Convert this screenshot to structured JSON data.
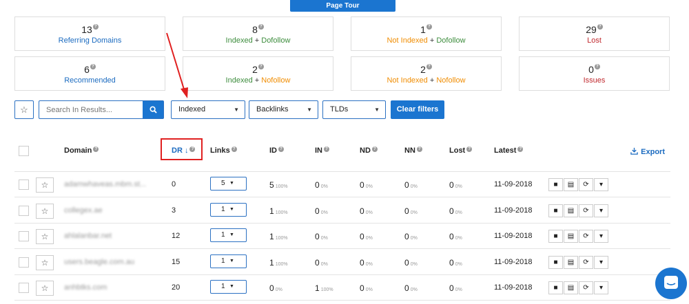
{
  "page_tour_label": "Page Tour",
  "stats": [
    {
      "value": "13",
      "label": "Referring Domains"
    },
    {
      "value": "8",
      "label_a": "Indexed",
      "plus": " + ",
      "label_b": "Dofollow"
    },
    {
      "value": "1",
      "label_a": "Not Indexed",
      "plus": " + ",
      "label_b": "Dofollow"
    },
    {
      "value": "29",
      "label": "Lost"
    },
    {
      "value": "6",
      "label": "Recommended"
    },
    {
      "value": "2",
      "label_a": "Indexed",
      "plus": " + ",
      "label_b": "Nofollow"
    },
    {
      "value": "2",
      "label_a": "Not Indexed",
      "plus": " + ",
      "label_b": "Nofollow"
    },
    {
      "value": "0",
      "label": "Issues"
    }
  ],
  "filters": {
    "search_placeholder": "Search In Results...",
    "indexed": "Indexed",
    "backlinks": "Backlinks",
    "tlds": "TLDs",
    "clear": "Clear filters"
  },
  "table": {
    "headers": {
      "domain": "Domain",
      "dr": "DR",
      "links": "Links",
      "id": "ID",
      "in": "IN",
      "nd": "ND",
      "nn": "NN",
      "lost": "Lost",
      "latest": "Latest",
      "export": "Export"
    },
    "rows": [
      {
        "domain": "adamwhaveas.mbm.st...",
        "dr": "0",
        "links": "5",
        "id": "5",
        "id_pct": "100%",
        "in": "0",
        "in_pct": "0%",
        "nd": "0",
        "nd_pct": "0%",
        "nn": "0",
        "nn_pct": "0%",
        "lost": "0",
        "lost_pct": "0%",
        "latest": "11-09-2018"
      },
      {
        "domain": "collegex.ae",
        "dr": "3",
        "links": "1",
        "id": "1",
        "id_pct": "100%",
        "in": "0",
        "in_pct": "0%",
        "nd": "0",
        "nd_pct": "0%",
        "nn": "0",
        "nn_pct": "0%",
        "lost": "0",
        "lost_pct": "0%",
        "latest": "11-09-2018"
      },
      {
        "domain": "ahlalanbar.net",
        "dr": "12",
        "links": "1",
        "id": "1",
        "id_pct": "100%",
        "in": "0",
        "in_pct": "0%",
        "nd": "0",
        "nd_pct": "0%",
        "nn": "0",
        "nn_pct": "0%",
        "lost": "0",
        "lost_pct": "0%",
        "latest": "11-09-2018"
      },
      {
        "domain": "users.beagle.com.au",
        "dr": "15",
        "links": "1",
        "id": "1",
        "id_pct": "100%",
        "in": "0",
        "in_pct": "0%",
        "nd": "0",
        "nd_pct": "0%",
        "nn": "0",
        "nn_pct": "0%",
        "lost": "0",
        "lost_pct": "0%",
        "latest": "11-09-2018"
      },
      {
        "domain": "anhbtks.com",
        "dr": "20",
        "links": "1",
        "id": "0",
        "id_pct": "0%",
        "in": "1",
        "in_pct": "100%",
        "nd": "0",
        "nd_pct": "0%",
        "nn": "0",
        "nn_pct": "0%",
        "lost": "0",
        "lost_pct": "0%",
        "latest": "11-09-2018"
      }
    ]
  },
  "colors": {
    "accent": "#1b75d0",
    "green": "#3c8c3c",
    "orange": "#f08c00",
    "red": "#c0282d",
    "annotation": "#e02020"
  }
}
